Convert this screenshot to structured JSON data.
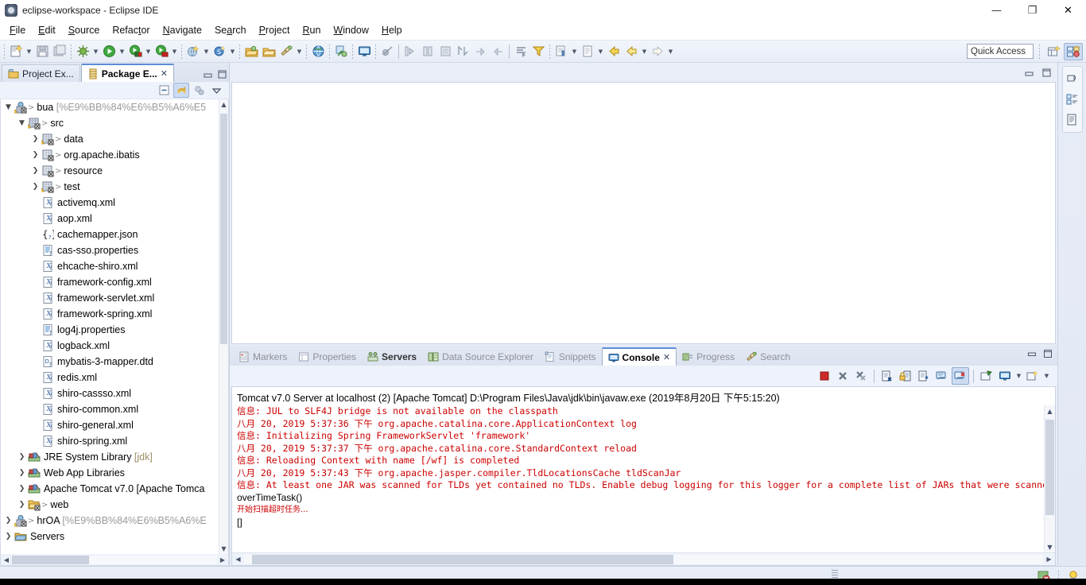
{
  "window": {
    "title": "eclipse-workspace - Eclipse IDE",
    "app_icon": "eclipse-icon",
    "minimize": "—",
    "maximize": "❐",
    "close": "✕"
  },
  "menubar": {
    "items": [
      {
        "label": "File",
        "mnemonic": "F"
      },
      {
        "label": "Edit",
        "mnemonic": "E"
      },
      {
        "label": "Source",
        "mnemonic": "S"
      },
      {
        "label": "Refactor",
        "mnemonic": "t"
      },
      {
        "label": "Navigate",
        "mnemonic": "N"
      },
      {
        "label": "Search",
        "mnemonic": "a"
      },
      {
        "label": "Project",
        "mnemonic": "P"
      },
      {
        "label": "Run",
        "mnemonic": "R"
      },
      {
        "label": "Window",
        "mnemonic": "W"
      },
      {
        "label": "Help",
        "mnemonic": "H"
      }
    ]
  },
  "toolbar": {
    "quick_access_placeholder": "Quick Access",
    "icons": [
      "new-wizard-icon",
      "save-icon",
      "save-all-icon",
      "debug-icon",
      "run-icon",
      "run-external-tools-icon",
      "run-stop-icon",
      "new-java-project-icon",
      "new-class-icon",
      "open-type-icon",
      "open-task-icon",
      "search-icon",
      "run-last-tool-icon",
      "open-web-browser-icon",
      "link-icon",
      "console-icon",
      "skip-breakpoints-icon",
      "step-into-icon",
      "step-over-icon",
      "terminate-icon",
      "toggle-breakpoint-icon",
      "next-annotation-icon",
      "previous-annotation-icon",
      "last-edit-location-icon",
      "back-icon",
      "forward-icon"
    ],
    "perspective_new_icon": "new-perspective-icon",
    "perspective_java_icon": "java-ee-perspective-icon"
  },
  "left_panel": {
    "tabs": [
      {
        "label": "Project Ex...",
        "icon": "project-explorer-icon",
        "active": false,
        "closable": false
      },
      {
        "label": "Package E...",
        "icon": "package-explorer-icon",
        "active": true,
        "closable": true
      }
    ],
    "view_toolbar": [
      {
        "name": "collapse-all-icon",
        "active": false
      },
      {
        "name": "link-with-editor-icon",
        "active": true
      },
      {
        "name": "focus-on-active-task-icon",
        "active": false
      },
      {
        "name": "view-menu-icon",
        "active": false
      }
    ],
    "minimize_icon": "minimize-icon",
    "maximize_icon": "maximize-icon",
    "tree": [
      {
        "indent": 0,
        "twist": "open",
        "icon": "java-project-warn-icon",
        "arrow": true,
        "label": "bua ",
        "dim": "[%E9%BB%84%E6%B5%A6%E5"
      },
      {
        "indent": 1,
        "twist": "open",
        "icon": "source-folder-warn-icon",
        "arrow": true,
        "label": "src",
        "dim": ""
      },
      {
        "indent": 2,
        "twist": "closed",
        "icon": "package-warn-icon",
        "arrow": true,
        "label": "data",
        "dim": ""
      },
      {
        "indent": 2,
        "twist": "closed",
        "icon": "package-icon",
        "arrow": true,
        "label": "org.apache.ibatis",
        "dim": ""
      },
      {
        "indent": 2,
        "twist": "closed",
        "icon": "package-icon",
        "arrow": true,
        "label": "resource",
        "dim": ""
      },
      {
        "indent": 2,
        "twist": "closed",
        "icon": "package-warn-icon",
        "arrow": true,
        "label": "test",
        "dim": ""
      },
      {
        "indent": 2,
        "twist": "none",
        "icon": "xml-file-icon",
        "arrow": false,
        "label": "activemq.xml",
        "dim": ""
      },
      {
        "indent": 2,
        "twist": "none",
        "icon": "xml-file-icon",
        "arrow": false,
        "label": "aop.xml",
        "dim": ""
      },
      {
        "indent": 2,
        "twist": "none",
        "icon": "json-file-icon",
        "arrow": false,
        "label": "cachemapper.json",
        "dim": ""
      },
      {
        "indent": 2,
        "twist": "none",
        "icon": "properties-file-icon",
        "arrow": false,
        "label": "cas-sso.properties",
        "dim": ""
      },
      {
        "indent": 2,
        "twist": "none",
        "icon": "xml-file-icon",
        "arrow": false,
        "label": "ehcache-shiro.xml",
        "dim": ""
      },
      {
        "indent": 2,
        "twist": "none",
        "icon": "xml-file-icon",
        "arrow": false,
        "label": "framework-config.xml",
        "dim": ""
      },
      {
        "indent": 2,
        "twist": "none",
        "icon": "xml-file-icon",
        "arrow": false,
        "label": "framework-servlet.xml",
        "dim": ""
      },
      {
        "indent": 2,
        "twist": "none",
        "icon": "xml-file-icon",
        "arrow": false,
        "label": "framework-spring.xml",
        "dim": ""
      },
      {
        "indent": 2,
        "twist": "none",
        "icon": "properties-file-icon",
        "arrow": false,
        "label": "log4j.properties",
        "dim": ""
      },
      {
        "indent": 2,
        "twist": "none",
        "icon": "xml-file-icon",
        "arrow": false,
        "label": "logback.xml",
        "dim": ""
      },
      {
        "indent": 2,
        "twist": "none",
        "icon": "dtd-file-icon",
        "arrow": false,
        "label": "mybatis-3-mapper.dtd",
        "dim": ""
      },
      {
        "indent": 2,
        "twist": "none",
        "icon": "xml-file-icon",
        "arrow": false,
        "label": "redis.xml",
        "dim": ""
      },
      {
        "indent": 2,
        "twist": "none",
        "icon": "xml-file-icon",
        "arrow": false,
        "label": "shiro-cassso.xml",
        "dim": ""
      },
      {
        "indent": 2,
        "twist": "none",
        "icon": "xml-file-icon",
        "arrow": false,
        "label": "shiro-common.xml",
        "dim": ""
      },
      {
        "indent": 2,
        "twist": "none",
        "icon": "xml-file-icon",
        "arrow": false,
        "label": "shiro-general.xml",
        "dim": ""
      },
      {
        "indent": 2,
        "twist": "none",
        "icon": "xml-file-icon",
        "arrow": false,
        "label": "shiro-spring.xml",
        "dim": ""
      },
      {
        "indent": 1,
        "twist": "closed",
        "icon": "library-icon",
        "arrow": false,
        "label": "JRE System Library ",
        "jdk": "[jdk]"
      },
      {
        "indent": 1,
        "twist": "closed",
        "icon": "library-icon",
        "arrow": false,
        "label": "Web App Libraries",
        "dim": ""
      },
      {
        "indent": 1,
        "twist": "closed",
        "icon": "library-icon",
        "arrow": false,
        "label": "Apache Tomcat v7.0 [Apache Tomca",
        "dim": ""
      },
      {
        "indent": 1,
        "twist": "closed",
        "icon": "web-folder-icon",
        "arrow": true,
        "label": "web",
        "dim": ""
      },
      {
        "indent": 0,
        "twist": "closed",
        "icon": "java-project-warn-icon",
        "arrow": true,
        "label": "hrOA ",
        "dim": "[%E9%BB%84%E6%B5%A6%E"
      },
      {
        "indent": 0,
        "twist": "closed",
        "icon": "servers-folder-icon",
        "arrow": false,
        "label": "Servers",
        "dim": ""
      }
    ]
  },
  "editor_area": {
    "minimize_icon": "minimize-icon",
    "maximize_icon": "restore-icon"
  },
  "console_panel": {
    "tabs": [
      {
        "label": "Markers",
        "icon": "markers-icon",
        "state": "inactive"
      },
      {
        "label": "Properties",
        "icon": "properties-icon",
        "state": "inactive"
      },
      {
        "label": "Servers",
        "icon": "servers-icon",
        "state": "bold"
      },
      {
        "label": "Data Source Explorer",
        "icon": "data-source-explorer-icon",
        "state": "inactive"
      },
      {
        "label": "Snippets",
        "icon": "snippets-icon",
        "state": "inactive"
      },
      {
        "label": "Console",
        "icon": "console-icon",
        "state": "active",
        "closable": true
      },
      {
        "label": "Progress",
        "icon": "progress-icon",
        "state": "inactive"
      },
      {
        "label": "Search",
        "icon": "search-icon",
        "state": "inactive"
      }
    ],
    "minimize_icon": "minimize-icon",
    "maximize_icon": "maximize-icon",
    "toolbar_icons": [
      {
        "name": "terminate-icon",
        "active": false
      },
      {
        "name": "remove-launch-icon",
        "active": false
      },
      {
        "name": "remove-all-terminated-icon",
        "active": false
      },
      {
        "name": "clear-console-icon",
        "active": false
      },
      {
        "name": "scroll-lock-icon",
        "active": false
      },
      {
        "name": "word-wrap-icon",
        "active": false
      },
      {
        "name": "show-console-on-output-icon",
        "active": false
      },
      {
        "name": "pin-console-icon",
        "active": true
      },
      {
        "name": "new-console-view-icon",
        "active": false
      },
      {
        "name": "display-selected-console-icon",
        "active": false
      },
      {
        "name": "open-console-icon",
        "active": false
      }
    ],
    "header": "Tomcat v7.0 Server at localhost (2) [Apache Tomcat] D:\\Program Files\\Java\\jdk\\bin\\javaw.exe (2019年8月20日 下午5:15:20)",
    "lines": [
      {
        "text": "信息: JUL to SLF4J bridge is not available on the classpath",
        "color": "#cc0000",
        "style": "mono"
      },
      {
        "text": "八月 20, 2019 5:37:36 下午 org.apache.catalina.core.ApplicationContext log",
        "color": "#cc0000",
        "style": "mono"
      },
      {
        "text": "信息: Initializing Spring FrameworkServlet 'framework'",
        "color": "#cc0000",
        "style": "mono"
      },
      {
        "text": "八月 20, 2019 5:37:37 下午 org.apache.catalina.core.StandardContext reload",
        "color": "#cc0000",
        "style": "mono"
      },
      {
        "text": "信息: Reloading Context with name [/wf] is completed",
        "color": "#cc0000",
        "style": "mono"
      },
      {
        "text": "八月 20, 2019 5:37:43 下午 org.apache.jasper.compiler.TldLocationsCache tldScanJar",
        "color": "#cc0000",
        "style": "mono"
      },
      {
        "text": "信息: At least one JAR was scanned for TLDs yet contained no TLDs. Enable debug logging for this logger for a complete list of JARs that were scanne",
        "color": "#cc0000",
        "style": "mono"
      },
      {
        "text": "overTimeTask()",
        "color": "#000000",
        "style": "sans"
      },
      {
        "text": "开始扫描超时任务...",
        "color": "#cc0000",
        "style": "cjk"
      },
      {
        "text": "[]",
        "color": "#000000",
        "style": "sans"
      }
    ]
  },
  "fast_view_strip": {
    "icons": [
      {
        "name": "restore-view-icon",
        "active": false
      },
      {
        "name": "outline-view-icon",
        "active": false
      },
      {
        "name": "task-list-icon",
        "active": false
      }
    ]
  },
  "statusbar": {
    "right_icons": [
      {
        "name": "heap-status-icon"
      },
      {
        "name": "tip-of-the-day-icon"
      }
    ]
  },
  "colors": {
    "accent": "#5b8dd6",
    "console_error": "#cc0000",
    "panel_bg": "#eef2fa",
    "tab_active": "#ffffff",
    "selection": "#cddcf2"
  }
}
